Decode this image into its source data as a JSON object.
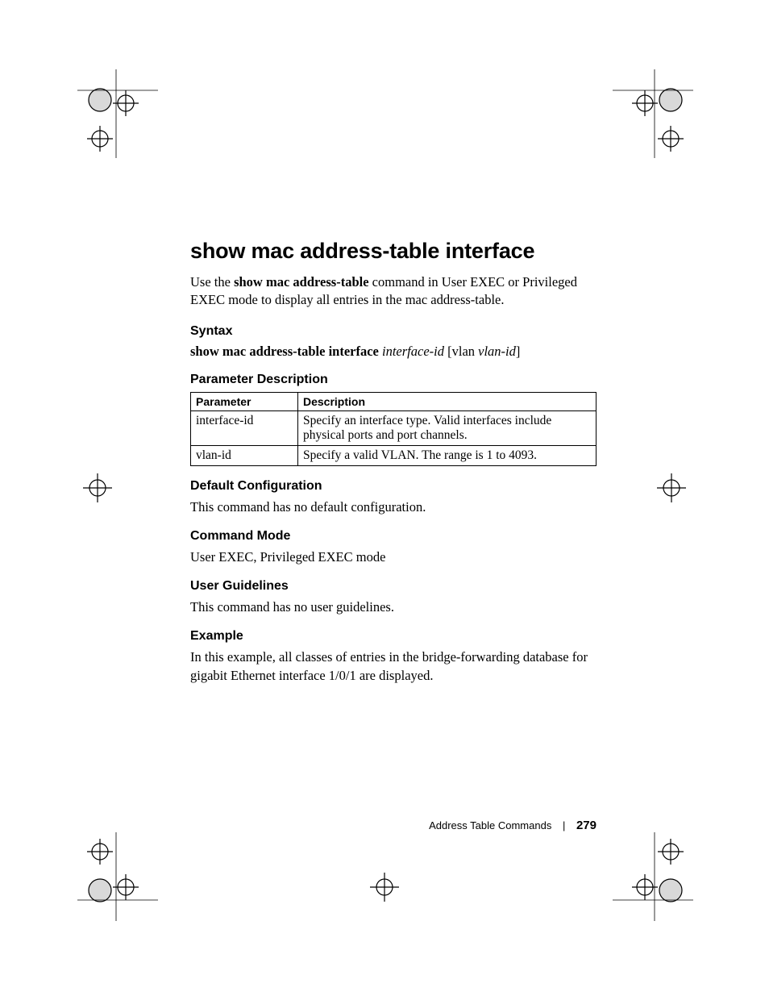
{
  "title": "show mac address-table interface",
  "intro_pre": "Use the ",
  "intro_bold": "show mac address-table",
  "intro_post": " command in User EXEC or Privileged EXEC mode to display all entries in the mac address-table.",
  "syntax_heading": "Syntax",
  "syntax_cmd": "show mac address-table interface ",
  "syntax_arg1": "interface-id",
  "syntax_vlan": " [vlan ",
  "syntax_arg2": "vlan-id",
  "syntax_close": "]",
  "param_heading": "Parameter Description",
  "table": {
    "head_param": "Parameter",
    "head_desc": "Description",
    "rows": [
      {
        "param": "interface-id",
        "desc": "Specify an interface type. Valid interfaces include physical ports and port channels."
      },
      {
        "param": "vlan-id",
        "desc": "Specify a valid VLAN. The range is 1 to 4093."
      }
    ]
  },
  "default_heading": "Default Configuration",
  "default_body": "This command has no default configuration.",
  "mode_heading": "Command Mode",
  "mode_body": "User EXEC, Privileged EXEC mode",
  "guidelines_heading": "User Guidelines",
  "guidelines_body": "This command has no user guidelines.",
  "example_heading": "Example",
  "example_body": "In this example, all classes of entries in the bridge-forwarding database for gigabit Ethernet interface 1/0/1 are displayed.",
  "footer_section": "Address Table Commands",
  "footer_page": "279"
}
